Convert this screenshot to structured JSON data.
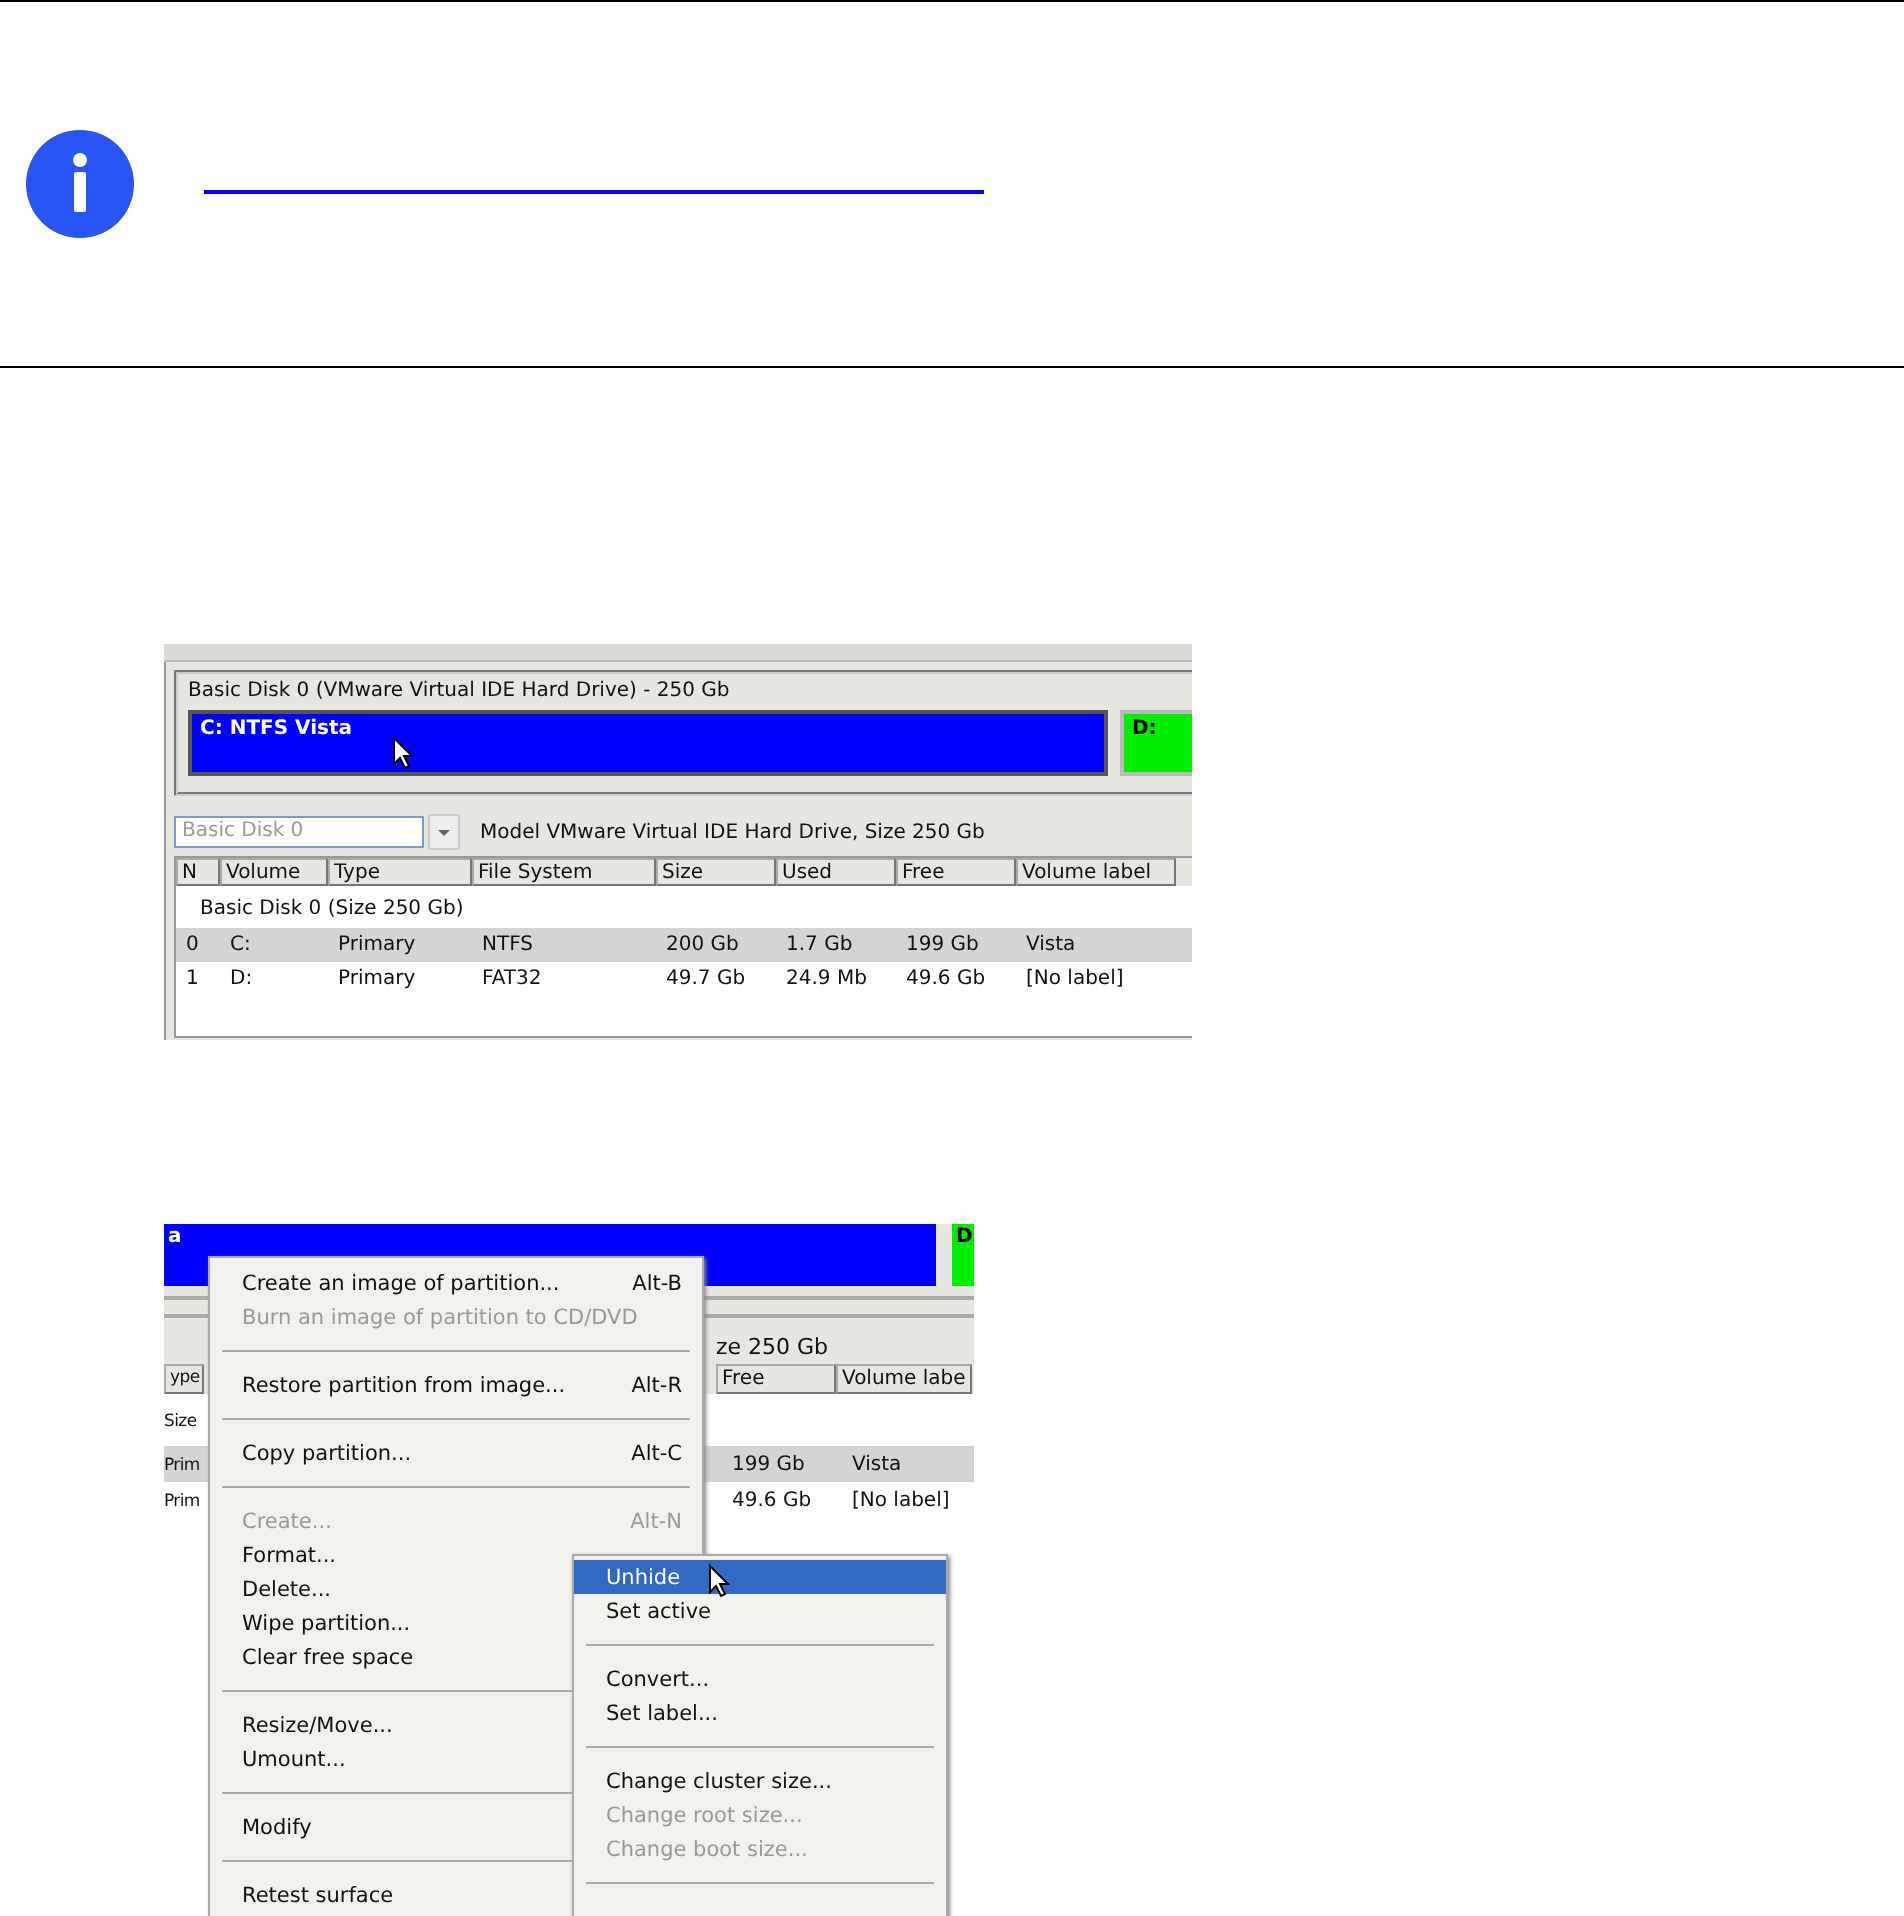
{
  "note": {
    "kind": "info"
  },
  "screenshot_1": {
    "disk_panel": {
      "title": "Basic Disk 0 (VMware Virtual IDE Hard Drive) - 250 Gb",
      "partitions": [
        {
          "label": "C: NTFS Vista",
          "color": "#0000ff",
          "selected": true
        },
        {
          "label": "D:",
          "color": "#00ee00",
          "selected": false
        }
      ]
    },
    "disk_select": {
      "value": "Basic Disk 0"
    },
    "model_text": "Model VMware Virtual IDE Hard Drive, Size 250 Gb",
    "columns": [
      "N",
      "Volume",
      "Type",
      "File System",
      "Size",
      "Used",
      "Free",
      "Volume label"
    ],
    "group": "Basic Disk 0 (Size 250 Gb)",
    "rows": [
      {
        "cells": [
          "0",
          "C:",
          "Primary",
          "NTFS",
          "200 Gb",
          "1.7 Gb",
          "199 Gb",
          "Vista"
        ],
        "selected": true
      },
      {
        "cells": [
          "1",
          "D:",
          "Primary",
          "FAT32",
          "49.7 Gb",
          "24.9 Mb",
          "49.6 Gb",
          "[No label]"
        ],
        "selected": false
      }
    ]
  },
  "screenshot_2": {
    "background": {
      "partitions": [
        {
          "label": "a",
          "color": "#0000ff"
        },
        {
          "label": "D",
          "color": "#00ee00"
        }
      ],
      "model_text": "ze 250 Gb",
      "columns": [
        "ype",
        "Free",
        "Volume labe"
      ],
      "group": "Size",
      "rows": [
        {
          "cells": [
            "Prim",
            "199 Gb",
            "Vista"
          ],
          "selected": true
        },
        {
          "cells": [
            "Prim",
            "49.6 Gb",
            "[No label]"
          ],
          "selected": false
        }
      ]
    },
    "menu": {
      "items": [
        {
          "kind": "item",
          "label": "Create an image of partition...",
          "shortcut": "Alt-B",
          "disabled": false,
          "selected": false
        },
        {
          "kind": "item",
          "label": "Burn an image of partition to CD/DVD",
          "disabled": true,
          "selected": false
        },
        {
          "kind": "separator"
        },
        {
          "kind": "item",
          "label": "Restore partition from image...",
          "shortcut": "Alt-R",
          "disabled": false,
          "selected": false
        },
        {
          "kind": "separator"
        },
        {
          "kind": "item",
          "label": "Copy partition...",
          "shortcut": "Alt-C",
          "disabled": false,
          "selected": false
        },
        {
          "kind": "separator"
        },
        {
          "kind": "item",
          "label": "Create...",
          "shortcut": "Alt-N",
          "disabled": true,
          "selected": false
        },
        {
          "kind": "item",
          "label": "Format...",
          "disabled": false,
          "selected": false
        },
        {
          "kind": "item",
          "label": "Delete...",
          "disabled": false,
          "selected": false
        },
        {
          "kind": "item",
          "label": "Wipe partition...",
          "disabled": false,
          "selected": false
        },
        {
          "kind": "item",
          "label": "Clear free space",
          "disabled": false,
          "selected": false
        },
        {
          "kind": "separator"
        },
        {
          "kind": "item",
          "label": "Resize/Move...",
          "disabled": false,
          "selected": false
        },
        {
          "kind": "item",
          "label": "Umount...",
          "disabled": false,
          "selected": false
        },
        {
          "kind": "separator"
        },
        {
          "kind": "item",
          "label": "Modify",
          "disabled": false,
          "selected": false
        },
        {
          "kind": "separator"
        },
        {
          "kind": "item",
          "label": "Retest surface",
          "disabled": false,
          "selected": false
        }
      ]
    },
    "submenu": {
      "items": [
        {
          "kind": "item",
          "label": "Unhide",
          "disabled": false,
          "selected": true
        },
        {
          "kind": "item",
          "label": "Set active",
          "disabled": false,
          "selected": false
        },
        {
          "kind": "separator"
        },
        {
          "kind": "item",
          "label": "Convert...",
          "disabled": false,
          "selected": false
        },
        {
          "kind": "item",
          "label": "Set label...",
          "disabled": false,
          "selected": false
        },
        {
          "kind": "separator"
        },
        {
          "kind": "item",
          "label": "Change cluster size...",
          "disabled": false,
          "selected": false
        },
        {
          "kind": "item",
          "label": "Change root size...",
          "disabled": true,
          "selected": false
        },
        {
          "kind": "item",
          "label": "Change boot size...",
          "disabled": true,
          "selected": false
        },
        {
          "kind": "separator"
        }
      ]
    }
  }
}
